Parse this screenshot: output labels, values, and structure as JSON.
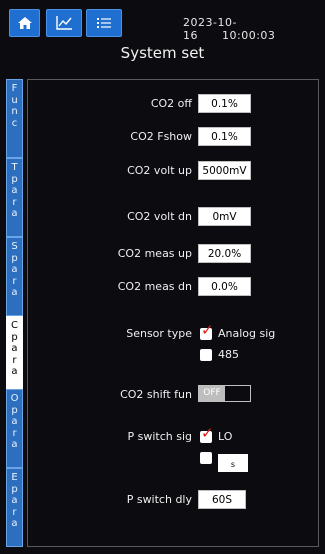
{
  "header": {
    "date": "2023-10-16",
    "time": "10:00:03",
    "title": "System set",
    "buttons": [
      {
        "icon": "home-icon"
      },
      {
        "icon": "chart-icon"
      },
      {
        "icon": "list-icon"
      }
    ]
  },
  "tabs": [
    {
      "label": "Func",
      "active": false
    },
    {
      "label": "Tpara",
      "active": false
    },
    {
      "label": "Spara",
      "active": false
    },
    {
      "label": "Cpara",
      "active": true
    },
    {
      "label": "Opara",
      "active": false
    },
    {
      "label": "Epara",
      "active": false
    }
  ],
  "settings": {
    "co2_off": {
      "label": "CO2 off",
      "value": "0.1%"
    },
    "co2_fshow": {
      "label": "CO2 Fshow",
      "value": "0.1%"
    },
    "co2_volt_up": {
      "label": "CO2 volt up",
      "value": "5000mV"
    },
    "co2_volt_dn": {
      "label": "CO2 volt dn",
      "value": "0mV"
    },
    "co2_meas_up": {
      "label": "CO2 meas up",
      "value": "20.0%"
    },
    "co2_meas_dn": {
      "label": "CO2 meas dn",
      "value": "0.0%"
    },
    "sensor_type": {
      "label": "Sensor type",
      "option1": "Analog sig",
      "option1_checked": true,
      "option2": "485",
      "option2_checked": false
    },
    "co2_shift_fun": {
      "label": "CO2 shift fun",
      "state": "OFF"
    },
    "p_switch_sig": {
      "label": "P switch sig",
      "option1": "LO",
      "option1_checked": true,
      "option2_checked": false,
      "option2_input": "s"
    },
    "p_switch_dly": {
      "label": "P switch dly",
      "value": "60S"
    }
  },
  "colors": {
    "accent": "#1f6fd0",
    "tab": "#2d6fbf",
    "check": "#e21a1a"
  }
}
